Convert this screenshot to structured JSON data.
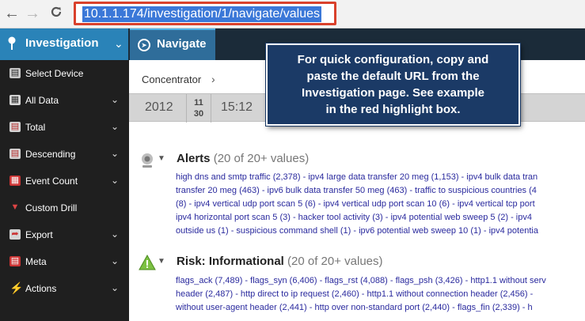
{
  "browser": {
    "url": "10.1.1.174/investigation/1/navigate/values",
    "back_icon": "←",
    "forward_icon": "→",
    "reload_icon": "C"
  },
  "topbar": {
    "investigation_label": "Investigation",
    "navigate_label": "Navigate"
  },
  "sidebar": {
    "items": [
      {
        "label": "Select Device",
        "icon": "device-icon",
        "chevron": false
      },
      {
        "label": "All Data",
        "icon": "grid-icon",
        "chevron": true
      },
      {
        "label": "Total",
        "icon": "total-icon",
        "chevron": true
      },
      {
        "label": "Descending",
        "icon": "descending-icon",
        "chevron": true
      },
      {
        "label": "Event Count",
        "icon": "event-count-icon",
        "chevron": true
      },
      {
        "label": "Custom Drill",
        "icon": "funnel-icon",
        "chevron": false
      },
      {
        "label": "Export",
        "icon": "export-icon",
        "chevron": true
      },
      {
        "label": "Meta",
        "icon": "meta-icon",
        "chevron": true
      },
      {
        "label": "Actions",
        "icon": "lightning-icon",
        "chevron": true
      }
    ]
  },
  "breadcrumb": {
    "label": "Concentrator",
    "chevron": "›"
  },
  "timebar": {
    "year": "2012",
    "month": "11",
    "day": "30",
    "time": "15:12"
  },
  "callout": {
    "lines": [
      "For quick configuration, copy and",
      "paste the default URL from the",
      "Investigation page.  See example",
      "in the red highlight box."
    ]
  },
  "alerts": {
    "title": "Alerts",
    "count_text": "(20 of 20+ values)",
    "rows": [
      "high dns and smtp traffic (2,378) - ipv4 large data transfer 20 meg (1,153) - ipv4 bulk data tran",
      "transfer 20 meg (463) - ipv6 bulk data transfer 50 meg (463) - traffic to suspicious countries (4",
      "(8) - ipv4 vertical udp port scan 5 (6) - ipv4 vertical udp port scan 10 (6) - ipv4 vertical tcp port",
      "ipv4 horizontal port scan 5 (3) - hacker tool activity (3) - ipv4 potential web sweep 5 (2) - ipv4",
      "outside us (1) - suspicious command shell (1) - ipv6 potential web sweep 10 (1) - ipv4 potentia"
    ]
  },
  "risk": {
    "title": "Risk: Informational",
    "count_text": "(20 of 20+ values)",
    "rows": [
      "flags_ack (7,489) - flags_syn (6,406) - flags_rst (4,088) - flags_psh (3,426) - http1.1 without serv",
      "header (2,487) - http direct to ip request (2,460) - http1.1 without connection header (2,456) -",
      "without user-agent header (2,441) - http over non-standard port (2,440) - flags_fin (2,339) - h"
    ]
  },
  "colors": {
    "accent": "#2a83b8",
    "callout": "#1b3a66",
    "highlight_border": "#d9412c"
  }
}
